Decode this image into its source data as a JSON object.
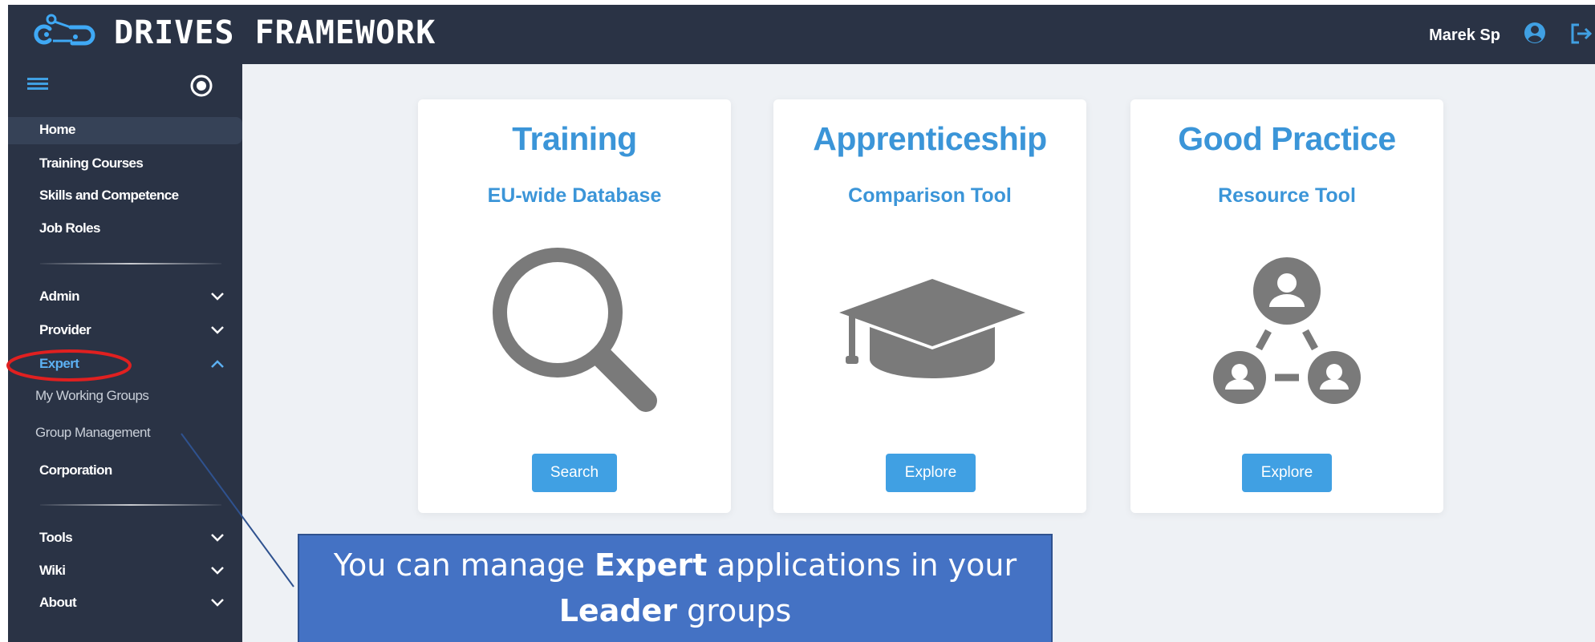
{
  "header": {
    "logo_text": "DRIVES FRAMEWORK",
    "user_name": "Marek Sp",
    "user_icon": "user-circle-icon",
    "logout_icon": "sign-out-icon"
  },
  "sidebar": {
    "menu_icon": "hamburger-menu-icon",
    "toggle_icon": "radio-toggle-icon",
    "items": [
      {
        "label": "Home"
      },
      {
        "label": "Training Courses"
      },
      {
        "label": "Skills and Competence"
      },
      {
        "label": "Job Roles"
      },
      {
        "label": "Admin"
      },
      {
        "label": "Provider"
      },
      {
        "label": "Expert"
      },
      {
        "label": "My Working Groups"
      },
      {
        "label": "Group Management"
      },
      {
        "label": "Corporation"
      },
      {
        "label": "Tools"
      },
      {
        "label": "Wiki"
      },
      {
        "label": "About"
      }
    ]
  },
  "cards": [
    {
      "title": "Training",
      "subtitle": "EU-wide Database",
      "icon": "magnifying-glass-icon",
      "button": "Search"
    },
    {
      "title": "Apprenticeship",
      "subtitle": "Comparison Tool",
      "icon": "graduation-cap-icon",
      "button": "Explore"
    },
    {
      "title": "Good Practice",
      "subtitle": "Resource Tool",
      "icon": "user-network-icon",
      "button": "Explore"
    }
  ],
  "annotation": {
    "line1_a": "You can manage ",
    "line1_b": "Expert",
    "line1_c": " applications in your",
    "line2_a": "Leader",
    "line2_b": " groups"
  },
  "colors": {
    "dark_bg": "#2a3345",
    "accent": "#3b95d8",
    "button": "#40a0e3",
    "callout": "#4472c4",
    "highlight_ellipse": "#e02020"
  }
}
